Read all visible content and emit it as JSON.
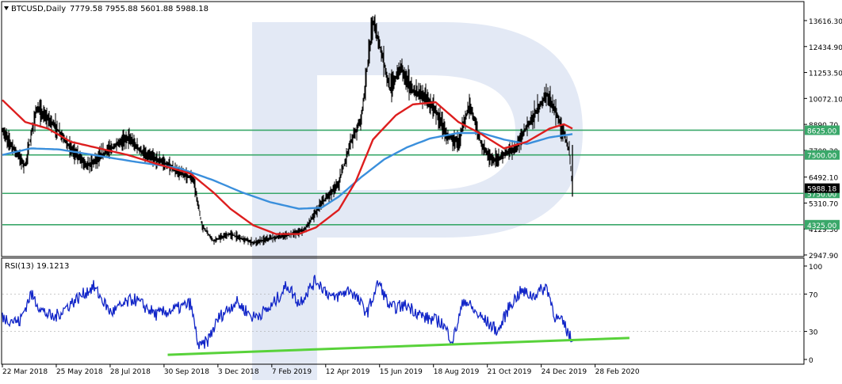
{
  "colors": {
    "background": "#ffffff",
    "frame": "#000000",
    "price_bars": "#000000",
    "ma_fast": "#dd1e1e",
    "ma_slow": "#3a8fdc",
    "hline": "#3aa86a",
    "hline_label_bg": "#3aa86a",
    "rsi_line": "#1226c8",
    "rsi_trendline": "#58d23a",
    "watermark": "#b8c8e4"
  },
  "header": {
    "symbol_label": "BTCUSD,Daily",
    "ohlc": "7779.58 7955.88 5601.88 5988.18",
    "collapse_icon": "triangle-down-icon"
  },
  "price_axis": {
    "ticks": [
      "13616.30",
      "12434.90",
      "11253.50",
      "10072.10",
      "8890.70",
      "7709.30",
      "6492.10",
      "5310.70",
      "4129.30",
      "2947.90"
    ],
    "current_price_label": "5988.18"
  },
  "horizontal_levels": [
    {
      "label": "8625.00",
      "value": 8625
    },
    {
      "label": "7500.00",
      "value": 7500
    },
    {
      "label": "5750.00",
      "value": 5750
    },
    {
      "label": "4325.00",
      "value": 4325
    }
  ],
  "rsi": {
    "title": "RSI(13) 19.1213",
    "ticks": [
      "100",
      "70",
      "30",
      "0"
    ],
    "levels": [
      70,
      30
    ]
  },
  "time_axis": {
    "labels": [
      "22 Mar 2018",
      "25 May 2018",
      "28 Jul 2018",
      "30 Sep 2018",
      "3 Dec 2018",
      "7 Feb 2019",
      "12 Apr 2019",
      "15 Jun 2019",
      "18 Aug 2019",
      "21 Oct 2019",
      "24 Dec 2019",
      "28 Feb 2020"
    ]
  },
  "chart_data": [
    {
      "type": "line",
      "title": "BTCUSD,Daily",
      "x": [
        "22 Mar 2018",
        "25 May 2018",
        "28 Jul 2018",
        "30 Sep 2018",
        "3 Dec 2018",
        "7 Feb 2019",
        "12 Apr 2019",
        "15 Jun 2019",
        "18 Aug 2019",
        "21 Oct 2019",
        "24 Dec 2019",
        "28 Feb 2020"
      ],
      "series": [],
      "price_path": [
        [
          0,
          8600
        ],
        [
          0.04,
          7000
        ],
        [
          0.06,
          9600
        ],
        [
          0.09,
          8900
        ],
        [
          0.12,
          7800
        ],
        [
          0.15,
          7000
        ],
        [
          0.18,
          7600
        ],
        [
          0.22,
          8300
        ],
        [
          0.25,
          7500
        ],
        [
          0.28,
          7200
        ],
        [
          0.31,
          6700
        ],
        [
          0.335,
          6450
        ],
        [
          0.35,
          4300
        ],
        [
          0.37,
          3600
        ],
        [
          0.4,
          3900
        ],
        [
          0.44,
          3500
        ],
        [
          0.47,
          3700
        ],
        [
          0.5,
          3850
        ],
        [
          0.53,
          4100
        ],
        [
          0.56,
          5300
        ],
        [
          0.59,
          6200
        ],
        [
          0.61,
          8000
        ],
        [
          0.63,
          9200
        ],
        [
          0.65,
          13600
        ],
        [
          0.665,
          12200
        ],
        [
          0.68,
          10500
        ],
        [
          0.7,
          11500
        ],
        [
          0.72,
          10400
        ],
        [
          0.74,
          10200
        ],
        [
          0.76,
          9500
        ],
        [
          0.78,
          8400
        ],
        [
          0.8,
          8100
        ],
        [
          0.82,
          9800
        ],
        [
          0.84,
          8000
        ],
        [
          0.86,
          7200
        ],
        [
          0.88,
          7500
        ],
        [
          0.9,
          7800
        ],
        [
          0.92,
          8800
        ],
        [
          0.94,
          9600
        ],
        [
          0.955,
          10300
        ],
        [
          0.97,
          9500
        ],
        [
          0.985,
          8500
        ],
        [
          0.995,
          7600
        ],
        [
          1.0,
          5988
        ]
      ],
      "ma_fast_path": [
        [
          0,
          10000
        ],
        [
          0.04,
          9000
        ],
        [
          0.08,
          8700
        ],
        [
          0.12,
          8100
        ],
        [
          0.17,
          7800
        ],
        [
          0.22,
          7500
        ],
        [
          0.27,
          7100
        ],
        [
          0.33,
          6650
        ],
        [
          0.37,
          5800
        ],
        [
          0.4,
          5050
        ],
        [
          0.44,
          4300
        ],
        [
          0.48,
          3900
        ],
        [
          0.52,
          3900
        ],
        [
          0.55,
          4200
        ],
        [
          0.59,
          5000
        ],
        [
          0.62,
          6300
        ],
        [
          0.65,
          8200
        ],
        [
          0.69,
          9300
        ],
        [
          0.72,
          9800
        ],
        [
          0.76,
          9900
        ],
        [
          0.8,
          9000
        ],
        [
          0.84,
          8450
        ],
        [
          0.88,
          7800
        ],
        [
          0.92,
          8100
        ],
        [
          0.96,
          8700
        ],
        [
          0.985,
          8900
        ],
        [
          1.0,
          8700
        ]
      ],
      "ma_slow_path": [
        [
          0,
          7500
        ],
        [
          0.05,
          7800
        ],
        [
          0.1,
          7750
        ],
        [
          0.16,
          7500
        ],
        [
          0.23,
          7200
        ],
        [
          0.31,
          6900
        ],
        [
          0.37,
          6350
        ],
        [
          0.42,
          5800
        ],
        [
          0.47,
          5350
        ],
        [
          0.52,
          5050
        ],
        [
          0.56,
          5100
        ],
        [
          0.59,
          5600
        ],
        [
          0.63,
          6500
        ],
        [
          0.67,
          7300
        ],
        [
          0.71,
          7850
        ],
        [
          0.75,
          8250
        ],
        [
          0.8,
          8500
        ],
        [
          0.84,
          8500
        ],
        [
          0.88,
          8200
        ],
        [
          0.92,
          8000
        ],
        [
          0.96,
          8300
        ],
        [
          1.0,
          8450
        ]
      ]
    },
    {
      "type": "line",
      "title": "RSI(13) 19.1213",
      "ylim": [
        0,
        100
      ],
      "series": [],
      "rsi_path": [
        [
          0,
          45
        ],
        [
          0.03,
          40
        ],
        [
          0.05,
          70
        ],
        [
          0.07,
          52
        ],
        [
          0.09,
          44
        ],
        [
          0.12,
          60
        ],
        [
          0.16,
          78
        ],
        [
          0.19,
          50
        ],
        [
          0.23,
          65
        ],
        [
          0.27,
          48
        ],
        [
          0.31,
          55
        ],
        [
          0.33,
          60
        ],
        [
          0.345,
          12
        ],
        [
          0.36,
          20
        ],
        [
          0.38,
          45
        ],
        [
          0.41,
          62
        ],
        [
          0.44,
          45
        ],
        [
          0.47,
          55
        ],
        [
          0.5,
          80
        ],
        [
          0.52,
          60
        ],
        [
          0.55,
          85
        ],
        [
          0.58,
          65
        ],
        [
          0.61,
          75
        ],
        [
          0.64,
          50
        ],
        [
          0.66,
          83
        ],
        [
          0.68,
          55
        ],
        [
          0.71,
          58
        ],
        [
          0.74,
          45
        ],
        [
          0.77,
          40
        ],
        [
          0.79,
          20
        ],
        [
          0.81,
          65
        ],
        [
          0.83,
          50
        ],
        [
          0.85,
          40
        ],
        [
          0.87,
          30
        ],
        [
          0.89,
          58
        ],
        [
          0.91,
          73
        ],
        [
          0.93,
          68
        ],
        [
          0.955,
          78
        ],
        [
          0.97,
          45
        ],
        [
          0.985,
          38
        ],
        [
          0.995,
          25
        ],
        [
          1.0,
          19
        ]
      ],
      "trendline": [
        [
          0.29,
          5
        ],
        [
          1.1,
          23
        ]
      ]
    }
  ]
}
